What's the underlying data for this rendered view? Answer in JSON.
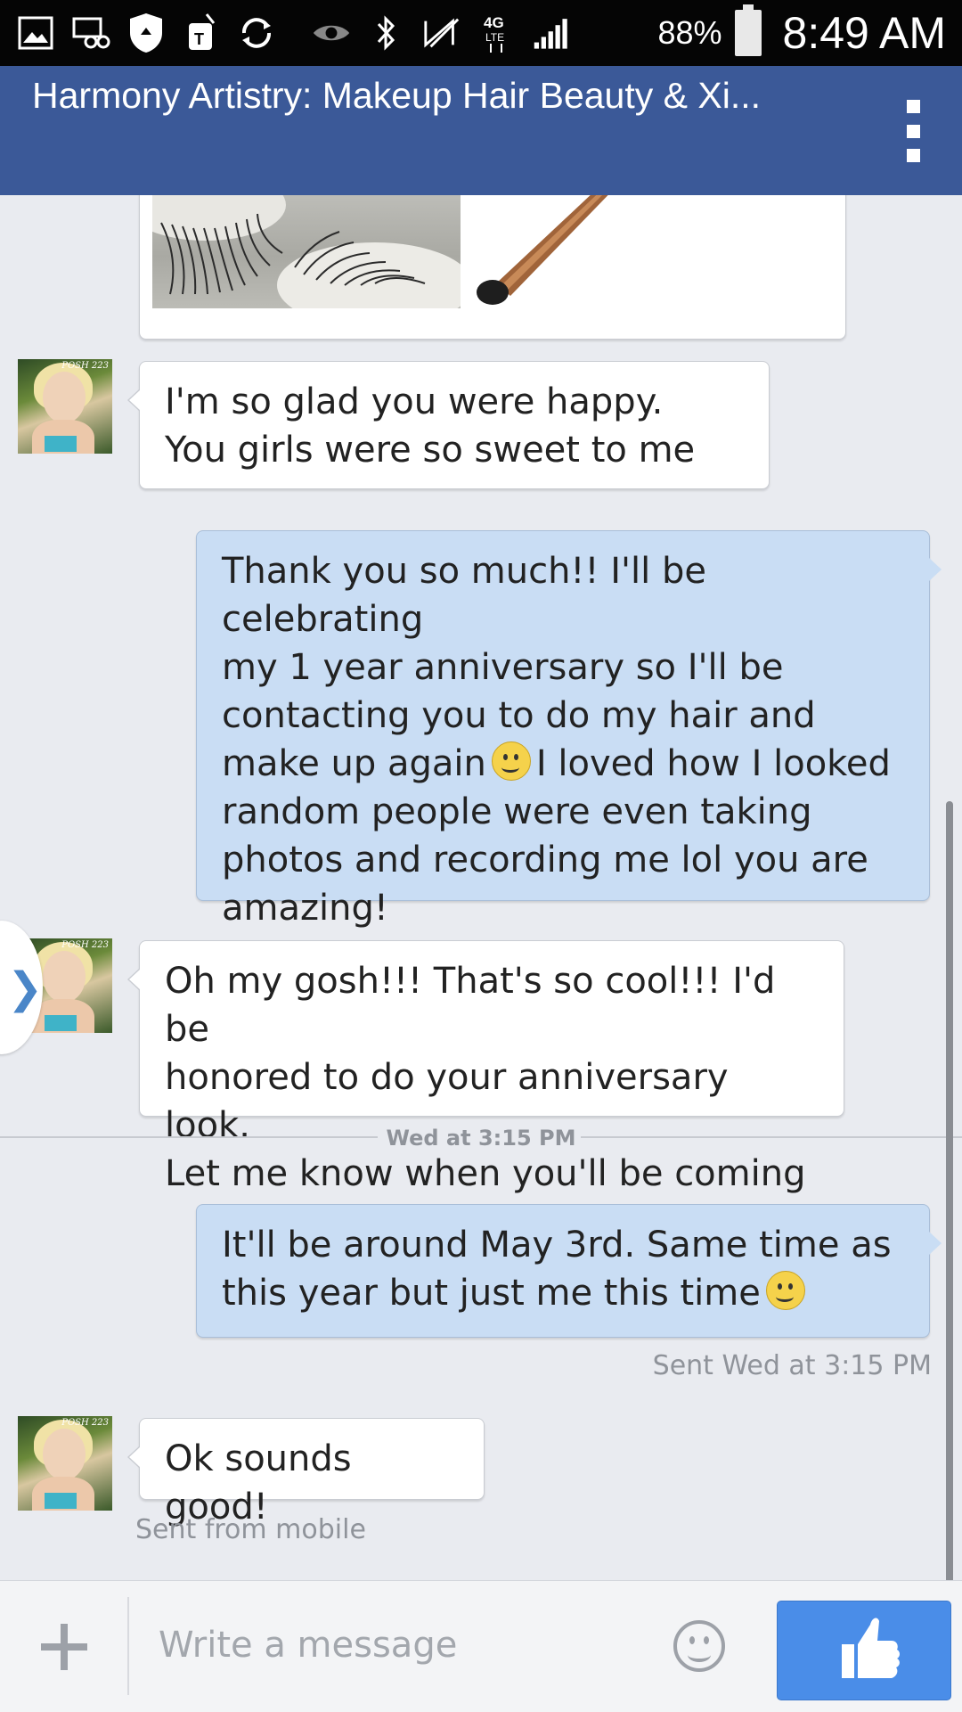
{
  "status_bar": {
    "battery": "88%",
    "time": "8:49 AM",
    "network": "4G LTE"
  },
  "app_bar": {
    "title": "Harmony Artistry: Makeup Hair Beauty & Xi..."
  },
  "messages": [
    {
      "direction": "incoming",
      "lines": [
        "I'm so glad you were happy.",
        "You girls were so sweet to me"
      ]
    },
    {
      "direction": "outgoing",
      "lines": [
        "Thank you so much!! I'll be celebrating",
        "my 1 year anniversary so I'll be",
        "contacting you to do my hair and",
        "make up again",
        "I loved how I looked",
        "random people were even taking",
        "photos and recording me lol you are",
        "amazing!"
      ]
    },
    {
      "direction": "incoming",
      "lines": [
        "Oh my gosh!!! That's so cool!!! I'd be",
        "honored to do your anniversary look.",
        "Let me know when you'll be coming"
      ]
    },
    {
      "direction": "outgoing",
      "lines": [
        "It'll be around May 3rd. Same time as",
        "this year but just me this time"
      ]
    },
    {
      "direction": "incoming",
      "lines": [
        "Ok sounds good!"
      ]
    }
  ],
  "timestamp_divider": "Wed at 3:15 PM",
  "sent_status": "Sent Wed at 3:15 PM",
  "sent_from": "Sent from mobile",
  "avatar_caption": "POSH 223",
  "composer": {
    "placeholder": "Write a message"
  },
  "colors": {
    "app_bar": "#3b5998",
    "outgoing_bubble": "#c9ddf4",
    "like_button": "#4a8de8"
  },
  "icons": {
    "status_bar": [
      "gallery-icon",
      "voicemail-icon",
      "shield-icon",
      "tmobile-icon",
      "sync-icon",
      "eye-icon",
      "bluetooth-icon",
      "nfc-icon",
      "signal-icon",
      "battery-icon"
    ],
    "composer": [
      "plus-icon",
      "emoji-icon",
      "thumbs-up-icon"
    ],
    "app_bar": [
      "overflow-menu-icon"
    ]
  }
}
